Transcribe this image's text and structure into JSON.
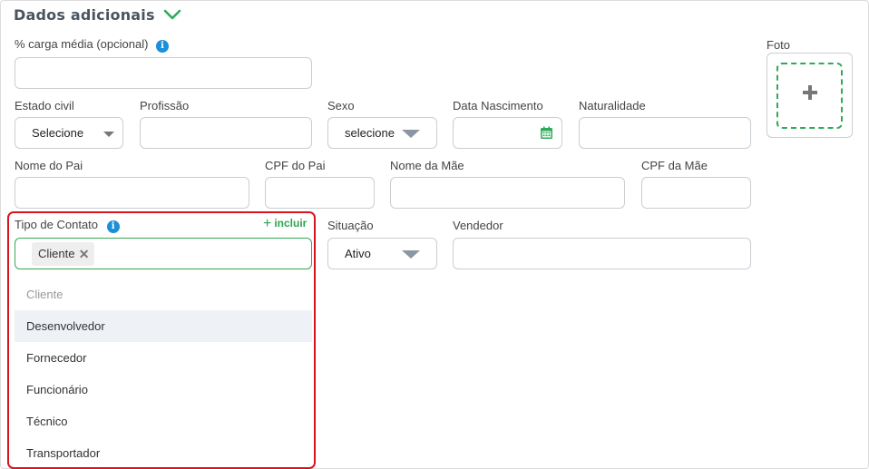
{
  "section": {
    "title": "Dados adicionais"
  },
  "fields": {
    "carga_media": {
      "label": "% carga média (opcional)",
      "value": ""
    },
    "estado_civil": {
      "label": "Estado civil",
      "value": "Selecione"
    },
    "profissao": {
      "label": "Profissão",
      "value": ""
    },
    "sexo": {
      "label": "Sexo",
      "value": "selecione"
    },
    "data_nascimento": {
      "label": "Data Nascimento",
      "value": ""
    },
    "naturalidade": {
      "label": "Naturalidade",
      "value": ""
    },
    "nome_pai": {
      "label": "Nome do Pai",
      "value": ""
    },
    "cpf_pai": {
      "label": "CPF do Pai",
      "value": ""
    },
    "nome_mae": {
      "label": "Nome da Mãe",
      "value": ""
    },
    "cpf_mae": {
      "label": "CPF da Mãe",
      "value": ""
    },
    "tipo_contato": {
      "label": "Tipo de Contato",
      "add_label": "incluir",
      "selected_tags": [
        "Cliente"
      ],
      "options": [
        {
          "label": "Cliente",
          "state": "disabled"
        },
        {
          "label": "Desenvolvedor",
          "state": "hover"
        },
        {
          "label": "Fornecedor",
          "state": "normal"
        },
        {
          "label": "Funcionário",
          "state": "normal"
        },
        {
          "label": "Técnico",
          "state": "normal"
        },
        {
          "label": "Transportador",
          "state": "normal"
        }
      ]
    },
    "situacao": {
      "label": "Situação",
      "value": "Ativo"
    },
    "vendedor": {
      "label": "Vendedor",
      "value": ""
    }
  },
  "foto": {
    "label": "Foto"
  },
  "icons": {
    "info": "info-icon",
    "chevron": "chevron-down-icon",
    "calendar": "calendar-icon",
    "plus": "plus-icon",
    "remove": "close-icon"
  },
  "colors": {
    "accent_green": "#2eaa5a",
    "info_blue": "#1c8fd8",
    "highlight_red": "#d9141e"
  }
}
